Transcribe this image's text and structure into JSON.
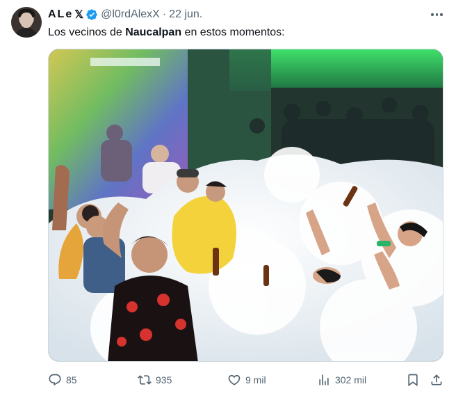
{
  "tweet": {
    "author": {
      "name": "ALe",
      "name_suffix": "𝕏",
      "handle": "@l0rdAlexX",
      "separator": "·",
      "time": "22 jun."
    },
    "text_before": "Los vecinos de ",
    "text_bold": "Naucalpan",
    "text_after": " en estos momentos:",
    "media": {
      "description_icon": "photo-foam-party"
    },
    "actions": {
      "replies": "85",
      "retweets": "935",
      "likes": "9 mil",
      "views": "302 mil"
    }
  },
  "colors": {
    "verified": "#1d9bf0",
    "secondary_text": "#536471"
  },
  "icons": [
    "verified-badge-icon",
    "more-icon",
    "reply-icon",
    "retweet-icon",
    "like-icon",
    "views-icon",
    "bookmark-icon",
    "share-icon"
  ]
}
